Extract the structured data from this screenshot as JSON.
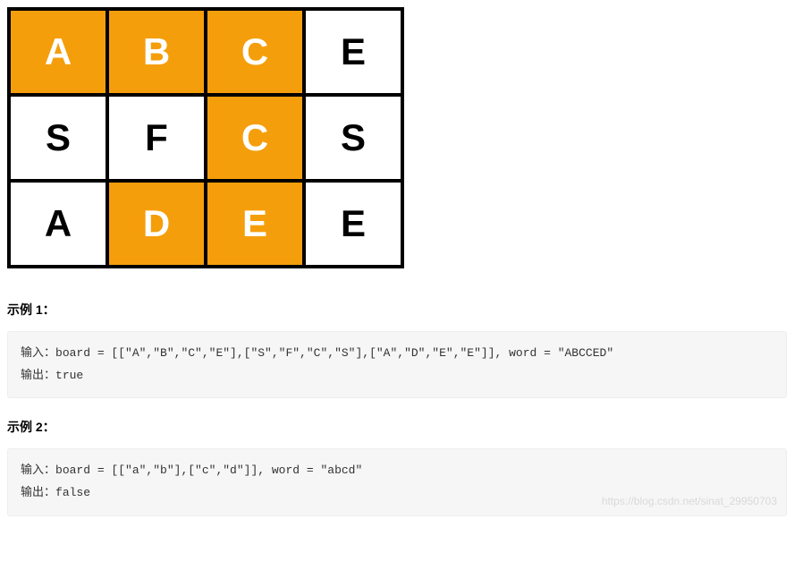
{
  "board": {
    "rows": [
      [
        {
          "char": "A",
          "hl": true
        },
        {
          "char": "B",
          "hl": true
        },
        {
          "char": "C",
          "hl": true
        },
        {
          "char": "E",
          "hl": false
        }
      ],
      [
        {
          "char": "S",
          "hl": false
        },
        {
          "char": "F",
          "hl": false
        },
        {
          "char": "C",
          "hl": true
        },
        {
          "char": "S",
          "hl": false
        }
      ],
      [
        {
          "char": "A",
          "hl": false
        },
        {
          "char": "D",
          "hl": true
        },
        {
          "char": "E",
          "hl": true
        },
        {
          "char": "E",
          "hl": false
        }
      ]
    ]
  },
  "examples": [
    {
      "title": "示例 1：",
      "input_label": "输入：",
      "input_code": "board = [[\"A\",\"B\",\"C\",\"E\"],[\"S\",\"F\",\"C\",\"S\"],[\"A\",\"D\",\"E\",\"E\"]], word = \"ABCCED\"",
      "output_label": "输出：",
      "output_code": "true"
    },
    {
      "title": "示例 2：",
      "input_label": "输入：",
      "input_code": "board = [[\"a\",\"b\"],[\"c\",\"d\"]], word = \"abcd\"",
      "output_label": "输出：",
      "output_code": "false"
    }
  ],
  "watermark": "https://blog.csdn.net/sinat_29950703"
}
